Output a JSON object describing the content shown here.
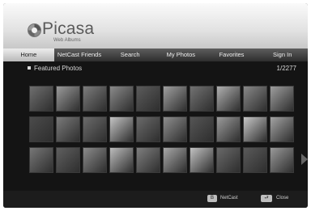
{
  "app": {
    "logo_name": "Picasa",
    "logo_sub": "Web Albums"
  },
  "tabs": [
    {
      "label": "Home",
      "active": true
    },
    {
      "label": "NetCast Friends",
      "active": false
    },
    {
      "label": "Search",
      "active": false
    },
    {
      "label": "My Photos",
      "active": false
    },
    {
      "label": "Favorites",
      "active": false
    },
    {
      "label": "Sign In",
      "active": false
    }
  ],
  "section": {
    "title": "Featured Photos",
    "page_count": "1/2277"
  },
  "photo_rows": [
    [
      "#6f6f6f",
      "#9a9a9a",
      "#7c7c7c",
      "#8a8a8a",
      "#5b5b5b",
      "#a0a0a0",
      "#727272",
      "#b0b0b0",
      "#888888",
      "#9e9e9e"
    ],
    [
      "#4b4b4b",
      "#7a7a7a",
      "#6b6b6b",
      "#c4c4c4",
      "#6a6a6a",
      "#8e8e8e",
      "#555555",
      "#9b9b9b",
      "#c7c7c7",
      "#a3a3a3"
    ],
    [
      "#777777",
      "#5f5f5f",
      "#8b8b8b",
      "#bcbcbc",
      "#7e7e7e",
      "#a8a8a8",
      "#c2c2c2",
      "#696969",
      "#5a5a5a",
      "#999999"
    ]
  ],
  "footer": {
    "netcast_key": "B",
    "netcast_label": "NetCast",
    "close_key": "⮐",
    "close_label": "Close"
  }
}
